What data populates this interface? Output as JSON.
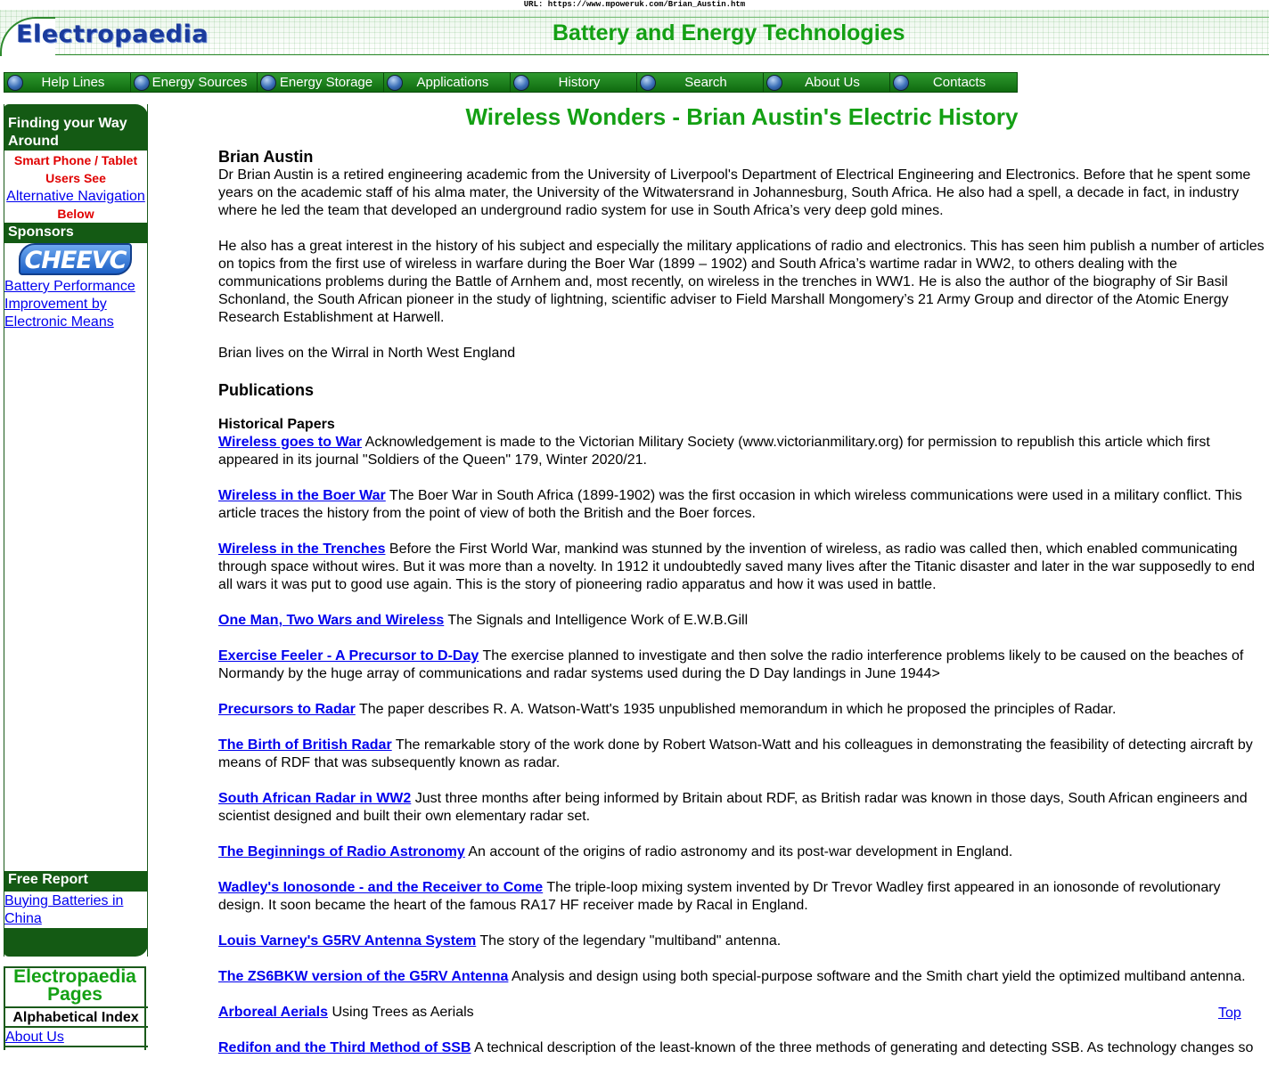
{
  "url_strip": "URL: https://www.mpoweruk.com/Brian_Austin.htm",
  "header": {
    "logo": "Electropaedia",
    "title": "Battery and Energy Technologies"
  },
  "nav": [
    {
      "label": "Help Lines"
    },
    {
      "label": "Energy Sources"
    },
    {
      "label": "Energy Storage"
    },
    {
      "label": "Applications"
    },
    {
      "label": "History"
    },
    {
      "label": "Search"
    },
    {
      "label": "About Us"
    },
    {
      "label": "Contacts"
    }
  ],
  "sidebar": {
    "finding_heading": "Finding your Way Around",
    "smart_phone_line1": "Smart Phone / Tablet",
    "smart_phone_line2": "Users See",
    "alt_nav_link": "Alternative Navigation",
    "below": "Below",
    "sponsors_heading": "Sponsors",
    "sponsor_logo": "CHEEVC",
    "sponsor_link": "Battery Performance Improvement by Electronic Means",
    "free_report_heading": "Free Report",
    "free_report_link": "Buying Batteries in China",
    "pages_title": "Electropaedia Pages",
    "alpha_index": "Alphabetical Index",
    "about_us": "About Us"
  },
  "main": {
    "title": "Wireless Wonders - Brian Austin's Electric History",
    "author_heading": "Brian Austin",
    "bio_p1": "Dr Brian Austin is a retired engineering academic from the University of Liverpool's Department of Electrical Engineering and Electronics. Before that he spent some years on the academic staff of his alma mater, the University of the Witwatersrand in Johannesburg, South Africa. He also had a spell, a decade in fact, in industry where he led the team that developed an underground radio system for use in South Africa’s very deep gold mines.",
    "bio_p2": "He also has a great interest in the history of his subject and especially the military applications of radio and electronics. This has seen him publish a number of articles on topics from the first use of wireless in warfare during the Boer War (1899 – 1902) and South Africa’s wartime radar in WW2, to others dealing with the communications problems during the Battle of Arnhem and, most recently, on wireless in the trenches in WW1. He is also the author of the biography of Sir Basil Schonland, the South African pioneer in the study of lightning, scientific adviser to Field Marshall Mongomery’s 21 Army Group and director of the Atomic Energy Research Establishment at Harwell.",
    "bio_p3": "Brian lives on the Wirral in North West England",
    "publications_heading": "Publications",
    "historical_heading": "Historical Papers",
    "papers": [
      {
        "link": "Wireless goes to War",
        "desc": " Acknowledgement is made to the Victorian Military Society (www.victorianmilitary.org) for permission to republish this article which first appeared in its journal \"Soldiers of the Queen\" 179, Winter 2020/21."
      },
      {
        "link": "Wireless in the Boer War",
        "desc": " The Boer War in South Africa (1899-1902) was the first occasion in which wireless communications were used in a military conflict. This article traces the history from the point of view of both the British and the Boer forces."
      },
      {
        "link": "Wireless in the Trenches",
        "desc": " Before the First World War, mankind was stunned by the invention of wireless, as radio was called then, which enabled communicating through space without wires. But it was more than a novelty. In 1912 it undoubtedly saved many lives after the Titanic disaster and later in the war supposedly to end all wars it was put to good use again. This is the story of pioneering radio apparatus and how it was used in battle."
      },
      {
        "link": "One Man, Two Wars and Wireless",
        "desc": " The Signals and Intelligence Work of E.W.B.Gill"
      },
      {
        "link": "Exercise Feeler - A Precursor to D-Day",
        "desc": " The exercise planned to investigate and then solve the radio interference problems likely to be caused on the beaches of Normandy by the huge array of communications and radar systems used during the D Day landings in June 1944>"
      },
      {
        "link": "Precursors to Radar",
        "desc": " The paper describes R. A. Watson-Watt's 1935 unpublished memorandum in which he proposed the principles of Radar."
      },
      {
        "link": "The Birth of British Radar",
        "desc": " The remarkable story of the work done by Robert Watson-Watt and his colleagues in demonstrating the feasibility of detecting aircraft by means of RDF that was subsequently known as radar."
      },
      {
        "link": "South African Radar in WW2",
        "desc": " Just three months after being informed by Britain about RDF, as British radar was known in those days, South African engineers and scientist designed and built their own elementary radar set."
      },
      {
        "link": "The Beginnings of Radio Astronomy",
        "desc": " An account of the origins of radio astronomy and its post-war development in England."
      },
      {
        "link": "Wadley's Ionosonde - and the Receiver to Come",
        "desc": " The triple-loop mixing system invented by Dr Trevor Wadley first appeared in an ionosonde of revolutionary design. It soon became the heart of the famous RA17 HF receiver made by Racal in England."
      },
      {
        "link": "Louis Varney's G5RV Antenna System",
        "desc": " The story of the legendary \"multiband\" antenna."
      },
      {
        "link": "The ZS6BKW version of the G5RV Antenna",
        "desc": " Analysis and design using both special-purpose software and the Smith chart yield the optimized multiband antenna."
      },
      {
        "link": "Arboreal Aerials",
        "desc": " Using Trees as Aerials"
      },
      {
        "link": "Redifon and the Third Method of SSB",
        "desc": " A technical description of the least-known of the three methods of generating and detecting SSB. As technology changes so"
      }
    ],
    "top_link": "Top"
  },
  "colors": {
    "brand_green": "#14a014",
    "sidebar_green": "#145a14",
    "link_blue": "#0000ee",
    "alert_red": "#e00000"
  }
}
